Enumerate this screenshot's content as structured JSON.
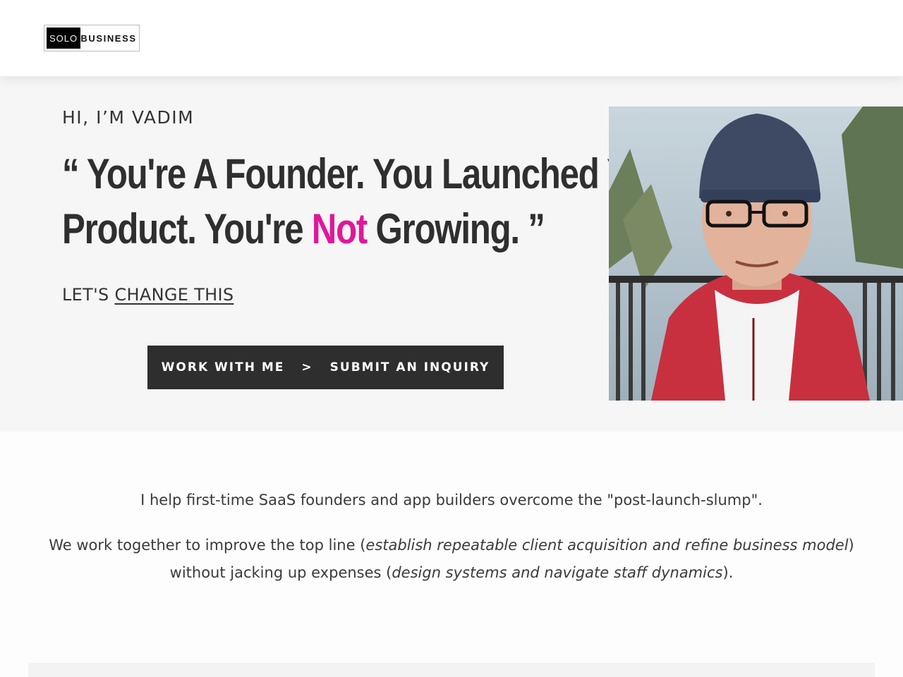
{
  "header": {
    "logo_left": "SOLO",
    "logo_right": "BUSINESS"
  },
  "hero": {
    "greeting": "HI, I’M VADIM",
    "headline_open_quote": "“",
    "headline_part1": "You're A Founder. You Launched Your",
    "headline_part2": "Product. You're",
    "headline_highlight": "Not",
    "headline_part3": "Growing.",
    "headline_close_quote": "”",
    "highlight_color": "#e0179a",
    "cta_prefix": "LET'S",
    "cta_link": "CHANGE THIS",
    "button_left": "WORK WITH ME",
    "button_separator": ">",
    "button_right": "SUBMIT AN INQUIRY",
    "photo_alt": "Portrait photo"
  },
  "intro": {
    "line1": "I help first-time SaaS founders and app builders overcome the \"post-launch-slump\".",
    "p2_a": "We work together to improve the top line (",
    "p2_em1": "establish repeatable client acquisition and refine business model",
    "p2_b": ") without jacking up expenses (",
    "p2_em2": "design systems and navigate staff dynamics",
    "p2_c": ")."
  }
}
